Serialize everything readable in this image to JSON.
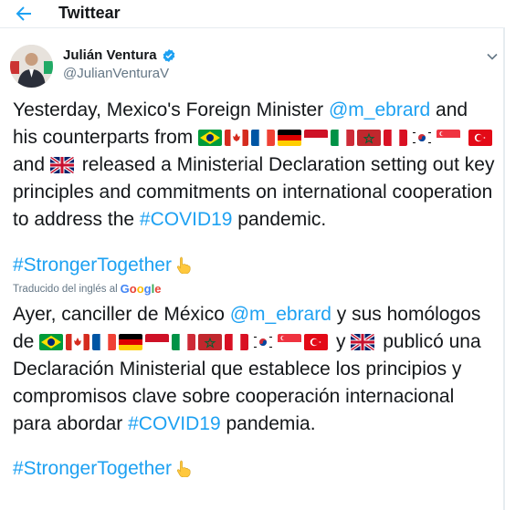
{
  "header": {
    "title": "Twittear",
    "back_icon": "back-arrow-icon"
  },
  "author": {
    "name": "Julián Ventura",
    "handle": "@JulianVenturaV",
    "verified_icon": "verified-badge-icon"
  },
  "english": {
    "p1": "Yesterday, Mexico's Foreign Minister ",
    "mention": "@m_ebrard",
    "p2": " and his counterparts from",
    "p3": " and",
    "p4": " released a Ministerial Declaration setting out key principles and commitments on international cooperation to address the ",
    "hashtag": "#COVID19",
    "p5": " pandemic."
  },
  "hashtag1": "#StrongerTogether",
  "translated_label": "Traducido del inglés al",
  "google": [
    "G",
    "o",
    "o",
    "g",
    "l",
    "e"
  ],
  "spanish": {
    "p1": "Ayer, canciller de México ",
    "mention": "@m_ebrard",
    "p2": " y sus homólogos de",
    "p3": " y",
    "p4": " publicó una Declaración Ministerial que establece los principios y compromisos clave sobre cooperación internacional para abordar ",
    "hashtag": "#COVID19",
    "p5": " pandemia."
  },
  "hashtag2": "#StrongerTogether",
  "colors": {
    "accent": "#1da1f2",
    "text": "#14171a",
    "secondary": "#657786"
  },
  "flags": [
    "brazil-flag-icon",
    "canada-flag-icon",
    "france-flag-icon",
    "germany-flag-icon",
    "indonesia-flag-icon",
    "italy-flag-icon",
    "morocco-flag-icon",
    "peru-flag-icon",
    "south-korea-flag-icon",
    "singapore-flag-icon",
    "turkey-flag-icon",
    "united-kingdom-flag-icon"
  ]
}
